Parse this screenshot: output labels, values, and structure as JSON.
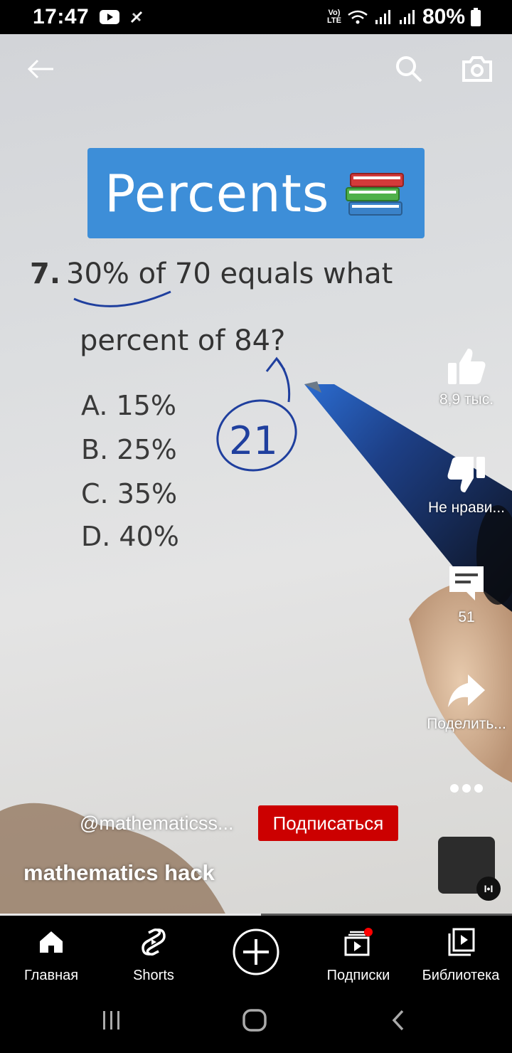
{
  "status_bar": {
    "time": "17:47",
    "battery": "80%",
    "network": "Vo) LTE"
  },
  "video": {
    "banner_title": "Percents",
    "question_number": "7.",
    "question_line1": "30% of 70 equals what",
    "question_line2": "percent of 84?",
    "options": [
      "A.  15%",
      "B.  25%",
      "C.  35%",
      "D.  40%"
    ],
    "handwritten_answer": "21",
    "progress": 0.51
  },
  "actions": {
    "like_count": "8,9 тыс.",
    "dislike_label": "Не нрави...",
    "comment_count": "51",
    "share_label": "Поделить..."
  },
  "channel": {
    "handle": "@mathematicss...",
    "subscribe_label": "Подписаться"
  },
  "video_title": "mathematics hack",
  "bottom_nav": {
    "home": "Главная",
    "shorts": "Shorts",
    "subscriptions": "Подписки",
    "library": "Библиотека"
  },
  "colors": {
    "subscribe": "#cc0000",
    "banner": "#3d8ed8",
    "ink": "#1f3f9e"
  },
  "icons": [
    "back-arrow-icon",
    "search-icon",
    "camera-icon",
    "like-icon",
    "dislike-icon",
    "comment-icon",
    "share-icon",
    "more-icon",
    "home-icon",
    "shorts-icon",
    "create-icon",
    "subscriptions-icon",
    "library-icon"
  ]
}
